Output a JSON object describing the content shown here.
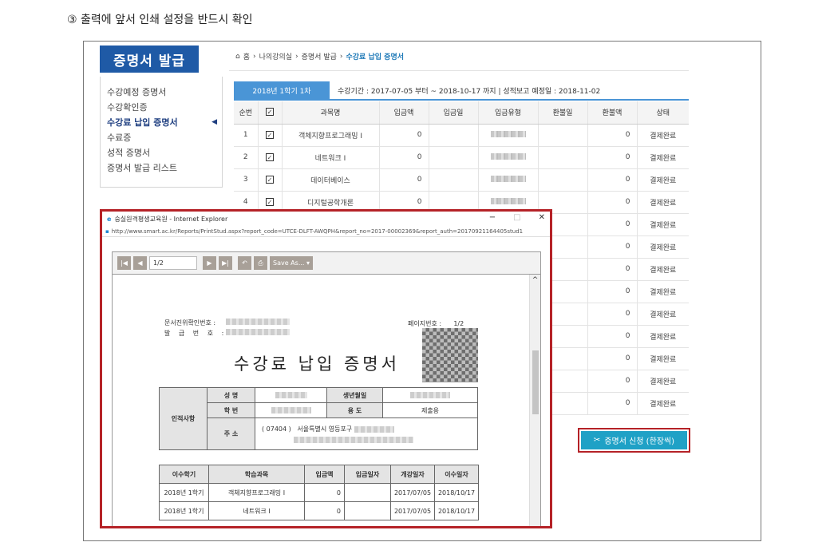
{
  "caption": "③ 출력에 앞서 인쇄 설정을 반드시 확인",
  "sidebar": {
    "title": "증명서 발급",
    "items": [
      "수강예정 증명서",
      "수강확인증",
      "수강료 납입 증명서",
      "수료증",
      "성적 증명서",
      "증명서 발급 리스트"
    ],
    "active": 2
  },
  "breadcrumb": {
    "home": "홈",
    "items": [
      "나의강의실",
      "증명서 발급"
    ],
    "current": "수강료 납입 증명서"
  },
  "semester": {
    "tab": "2018년 1학기 1차",
    "info": "수강기간 : 2017-07-05 부터 ~ 2018-10-17 까지   |   성적보고 예정일 : 2018-11-02"
  },
  "table": {
    "headers": [
      "순번",
      "",
      "과목명",
      "입금액",
      "입금일",
      "입금유형",
      "환불일",
      "환불액",
      "상태"
    ],
    "rows": [
      {
        "no": "1",
        "course": "객체지향프로그래밍 I",
        "amount": "0",
        "refund": "0",
        "status": "결제완료"
      },
      {
        "no": "2",
        "course": "네트워크 I",
        "amount": "0",
        "refund": "0",
        "status": "결제완료"
      },
      {
        "no": "3",
        "course": "데이터베이스",
        "amount": "0",
        "refund": "0",
        "status": "결제완료"
      },
      {
        "no": "4",
        "course": "디지털공학개론",
        "amount": "0",
        "refund": "0",
        "status": "결제완료"
      },
      {
        "no": "",
        "course": "",
        "amount": "",
        "refund": "0",
        "status": "결제완료"
      },
      {
        "no": "",
        "course": "",
        "amount": "",
        "refund": "0",
        "status": "결제완료"
      },
      {
        "no": "",
        "course": "",
        "amount": "",
        "refund": "0",
        "status": "결제완료"
      },
      {
        "no": "",
        "course": "",
        "amount": "",
        "refund": "0",
        "status": "결제완료"
      },
      {
        "no": "",
        "course": "",
        "amount": "",
        "refund": "0",
        "status": "결제완료"
      },
      {
        "no": "",
        "course": "",
        "amount": "",
        "refund": "0",
        "status": "결제완료"
      },
      {
        "no": "",
        "course": "",
        "amount": "",
        "refund": "0",
        "status": "결제완료"
      },
      {
        "no": "",
        "course": "",
        "amount": "",
        "refund": "0",
        "status": "결제완료"
      },
      {
        "no": "",
        "course": "",
        "amount": "",
        "refund": "0",
        "status": "결제완료"
      }
    ]
  },
  "apply_button": "증명서 신청 (한장씩)",
  "popup": {
    "title": "숭실원격평생교육원 - Internet Explorer",
    "url": "http://www.smart.ac.kr/Reports/PrintStud.aspx?report_code=UTCE-DLFT-AWQPH&report_no=2017-00002369&report_auth=20170921164405stud1",
    "page": "1/2",
    "save_label": "Save As...",
    "doc": {
      "confirm_label": "문서진위확인번호 :",
      "issue_label": "발 급 번 호 :",
      "page_label": "페이지번호 :",
      "page_value": "1/2",
      "title": "수강료 납입 증명서",
      "personal_label": "인적사항",
      "name_label": "성    명",
      "birth_label": "생년월일",
      "id_label": "학    번",
      "purpose_label": "용    도",
      "purpose_value": "제출용",
      "address_label": "주    소",
      "zip": "( 07404 )",
      "address": "서울특별시 영등포구",
      "hist_headers": [
        "이수학기",
        "학습과목",
        "입금액",
        "입금일자",
        "개강일자",
        "이수일자"
      ],
      "hist_rows": [
        [
          "2018년 1학기",
          "객체지향프로그래밍 I",
          "0",
          "",
          "2017/07/05",
          "2018/10/17"
        ],
        [
          "2018년 1학기",
          "네트워크 I",
          "0",
          "",
          "2017/07/05",
          "2018/10/17"
        ]
      ]
    }
  },
  "colors": {
    "brand": "#1f5aa6",
    "tab": "#4a95d6",
    "highlight": "#b52227",
    "button": "#1fa1c6"
  }
}
